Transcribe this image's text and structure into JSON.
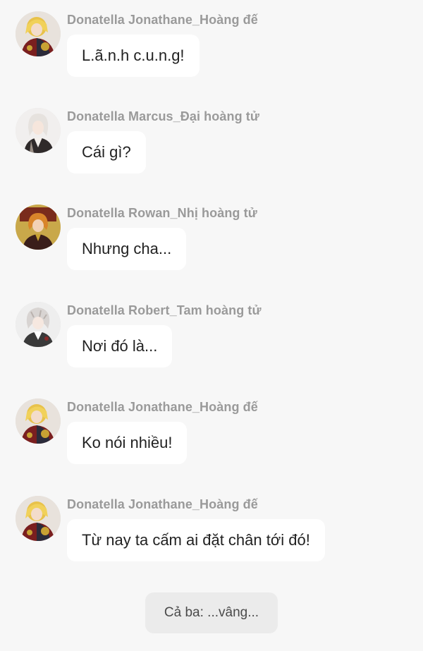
{
  "messages": [
    {
      "sender": "Donatella Jonathane_Hoàng đế",
      "text": "L.ã.n.h c.u.n.g!",
      "avatar": "jonathane-avatar"
    },
    {
      "sender": "Donatella Marcus_Đại hoàng tử",
      "text": "Cái gì?",
      "avatar": "marcus-avatar"
    },
    {
      "sender": "Donatella Rowan_Nhị hoàng tử",
      "text": "Nhưng cha...",
      "avatar": "rowan-avatar"
    },
    {
      "sender": "Donatella Robert_Tam hoàng tử",
      "text": "Nơi đó là...",
      "avatar": "robert-avatar"
    },
    {
      "sender": "Donatella Jonathane_Hoàng đế",
      "text": "Ko nói nhiều!",
      "avatar": "jonathane-avatar"
    },
    {
      "sender": "Donatella Jonathane_Hoàng đế",
      "text": "Từ nay ta cấm ai đặt chân tới đó!",
      "avatar": "jonathane-avatar"
    }
  ],
  "narration": "Cả ba: ...vâng...",
  "colors": {
    "background": "#f7f7f7",
    "bubble": "#ffffff",
    "sender_text": "#9a9a9a",
    "narration_bg": "#ebebeb"
  }
}
